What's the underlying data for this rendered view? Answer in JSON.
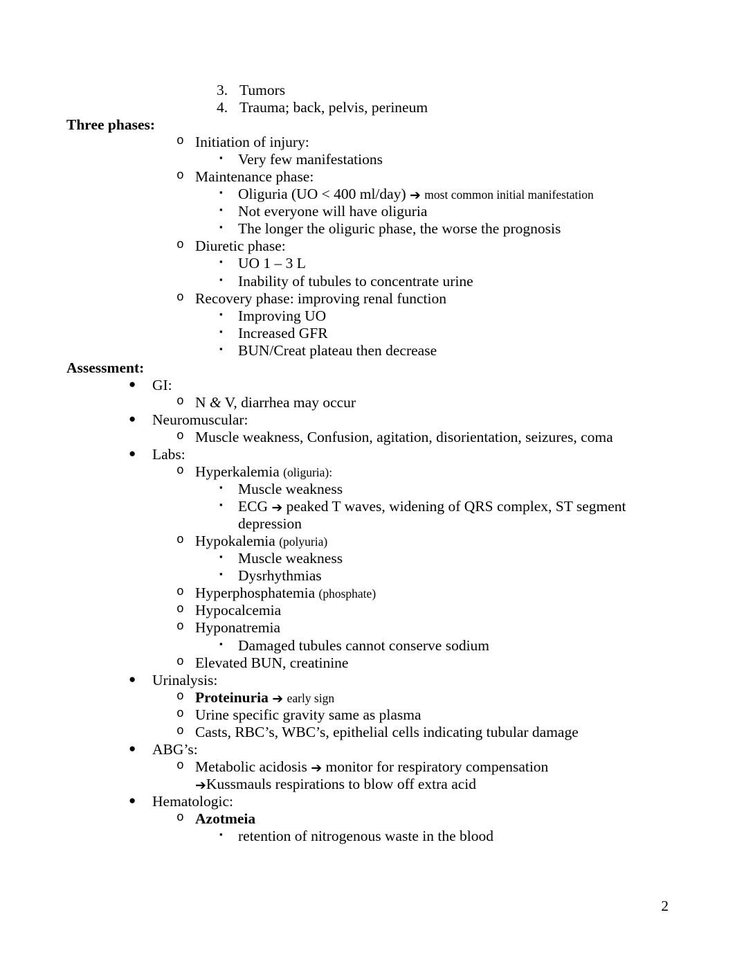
{
  "page": {
    "number": "2"
  },
  "content": {
    "numbered_items": [
      {
        "marker": "3.",
        "text": "Tumors"
      },
      {
        "marker": "4.",
        "text": "Trauma; back, pelvis, perineum"
      }
    ],
    "three_phases": {
      "heading": "Three phases:",
      "items": [
        {
          "label": "Initiation of injury:",
          "subs": [
            "Very few manifestations"
          ]
        },
        {
          "label": "Maintenance phase:",
          "subs": [
            "Oliguria (UO < 400 ml/day)",
            "Not everyone will have oliguria",
            "The longer the oliguric phase, the worse the prognosis"
          ],
          "sub_arrow_tail": "most common initial manifestation"
        },
        {
          "label": "Diuretic phase:",
          "subs": [
            "UO 1 – 3 L",
            "Inability of tubules to concentrate urine"
          ]
        },
        {
          "label": "Recovery phase: improving renal function",
          "subs": [
            "Improving UO",
            "Increased GFR",
            "BUN/Creat plateau then decrease"
          ]
        }
      ]
    },
    "assessment": {
      "heading": "Assessment:",
      "gi": {
        "label": "GI:",
        "sub_pre": "N ",
        "sub_amp": "&",
        "sub_post": " V, diarrhea may occur"
      },
      "neuromuscular": {
        "label": "Neuromuscular:",
        "sub": "Muscle weakness, Confusion, agitation, disorientation, seizures, coma"
      },
      "labs": {
        "label": "Labs:",
        "hyperkalemia": {
          "main": "Hyperkalemia",
          "paren": "(oliguria):",
          "subs": [
            "Muscle weakness"
          ],
          "ecg_head": "ECG",
          "ecg_tail": "peaked T waves, widening of QRS complex, ST segment depression"
        },
        "hypokalemia": {
          "main": "Hypokalemia",
          "paren": "(polyuria)",
          "subs": [
            "Muscle weakness",
            "Dysrhythmias"
          ]
        },
        "hyperphosphatemia": {
          "main": "Hyperphosphatemia",
          "paren": "(phosphate)"
        },
        "hypocalcemia": "Hypocalcemia",
        "hyponatremia": {
          "main": "Hyponatremia",
          "subs": [
            "Damaged tubules cannot conserve sodium"
          ]
        },
        "elevated": "Elevated BUN, creatinine"
      },
      "urinalysis": {
        "label": "Urinalysis:",
        "proteinuria_bold": "Proteinuria",
        "proteinuria_tail": "early sign",
        "items": [
          "Urine specific gravity same as plasma",
          "Casts, RBC’s, WBC’s, epithelial cells indicating tubular damage"
        ]
      },
      "abg": {
        "label": "ABG’s:",
        "metabolic_head": "Metabolic acidosis",
        "metabolic_tail": "monitor for respiratory compensation",
        "kussmauls": "Kussmauls respirations to blow off extra acid"
      },
      "hematologic": {
        "label": "Hematologic:",
        "azotmeia": "Azotmeia",
        "azotmeia_sub": "retention of nitrogenous waste in the blood"
      }
    }
  },
  "glyphs": {
    "arrow": "➔",
    "bullet_round": "●",
    "bullet_square": "▪",
    "bullet_o": "o"
  }
}
